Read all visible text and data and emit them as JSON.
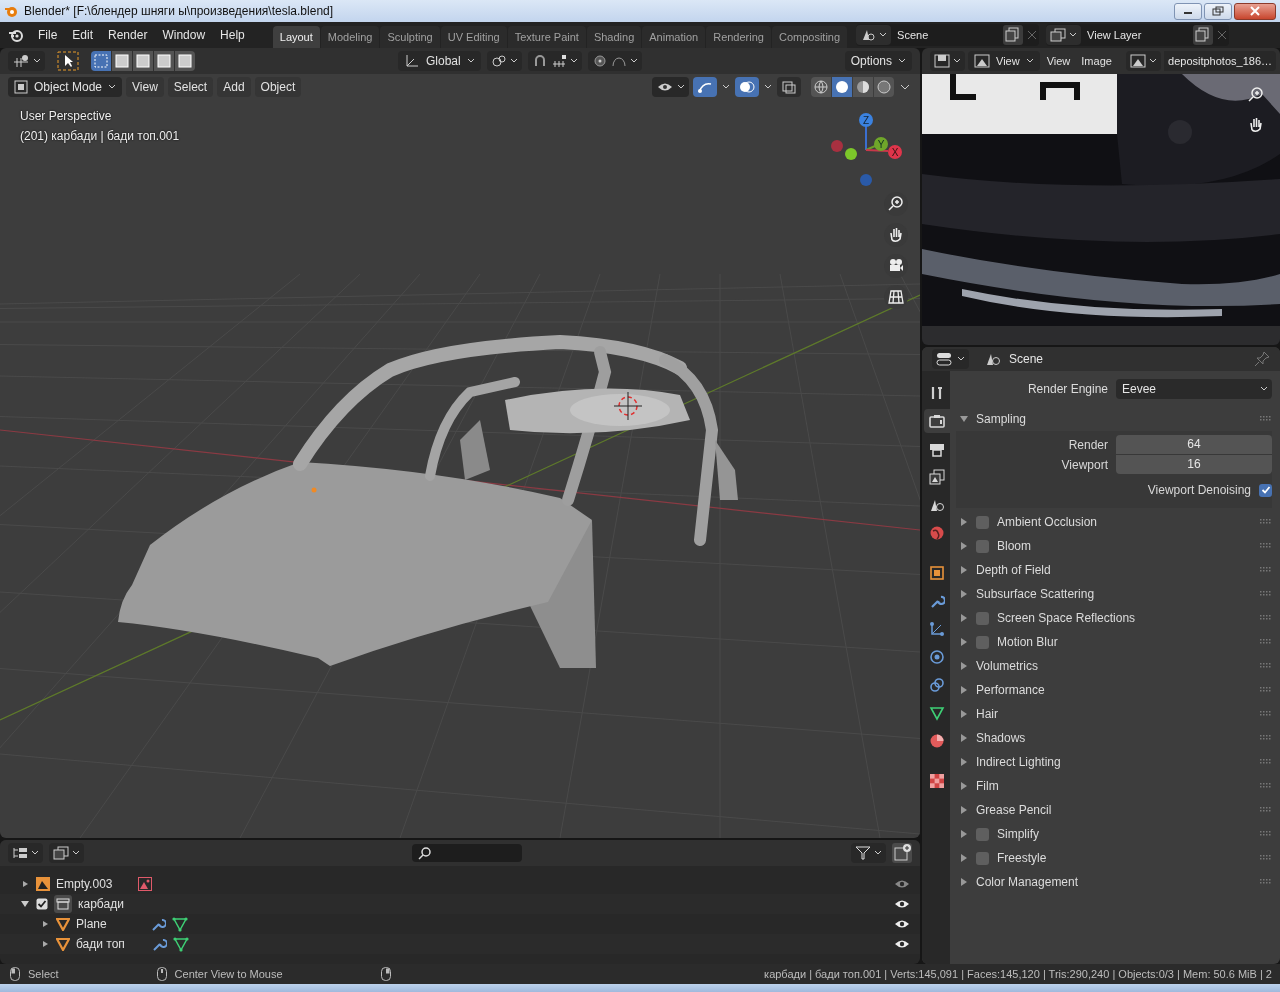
{
  "window": {
    "title": "Blender* [F:\\блендер шняги ы\\произведения\\tesla.blend]"
  },
  "menu": [
    "File",
    "Edit",
    "Render",
    "Window",
    "Help"
  ],
  "workspaces": [
    {
      "label": "Layout",
      "selected": true
    },
    {
      "label": "Modeling",
      "selected": false
    },
    {
      "label": "Sculpting",
      "selected": false
    },
    {
      "label": "UV Editing",
      "selected": false
    },
    {
      "label": "Texture Paint",
      "selected": false
    },
    {
      "label": "Shading",
      "selected": false
    },
    {
      "label": "Animation",
      "selected": false
    },
    {
      "label": "Rendering",
      "selected": false
    },
    {
      "label": "Compositing",
      "selected": false
    }
  ],
  "scene_field": {
    "value": "Scene"
  },
  "view_layer_field": {
    "value": "View Layer"
  },
  "viewport": {
    "select_modes": [
      {
        "selected": true
      },
      {
        "selected": false
      },
      {
        "selected": false
      },
      {
        "selected": false
      },
      {
        "selected": false
      }
    ],
    "transform_orientation": "Global",
    "options": "Options",
    "mode": "Object Mode",
    "menus": [
      "View",
      "Select",
      "Add",
      "Object"
    ],
    "toggles": [
      {
        "kind": "gizmo",
        "on": true
      },
      {
        "kind": "overlays",
        "on": true
      },
      {
        "kind": "xray",
        "on": false
      }
    ],
    "shading": [
      {
        "kind": "wireframe",
        "selected": false
      },
      {
        "kind": "solid",
        "selected": true
      },
      {
        "kind": "material",
        "selected": false
      },
      {
        "kind": "rendered",
        "selected": false
      }
    ],
    "info": [
      "User Perspective",
      "(201) карбади | бади топ.001"
    ],
    "gizmo_axes": [
      "Z",
      "Y",
      "X"
    ]
  },
  "image_editor": {
    "view_mode": "View",
    "menus": [
      "View",
      "Image"
    ],
    "image_name": "depositphotos_186…"
  },
  "properties": {
    "context": "Scene",
    "tabs": [
      {
        "kind": "tool",
        "selected": false
      },
      {
        "kind": "render",
        "selected": true
      },
      {
        "kind": "output",
        "selected": false
      },
      {
        "kind": "view-layer",
        "selected": false
      },
      {
        "kind": "scene",
        "selected": false
      },
      {
        "kind": "world",
        "selected": false
      },
      {
        "kind": "object",
        "selected": false
      },
      {
        "kind": "modifier",
        "selected": false
      },
      {
        "kind": "particles",
        "selected": false
      },
      {
        "kind": "physics",
        "selected": false
      },
      {
        "kind": "constraints",
        "selected": false
      },
      {
        "kind": "data",
        "selected": false
      },
      {
        "kind": "material",
        "selected": false
      },
      {
        "kind": "texture",
        "selected": false
      }
    ],
    "render_engine": {
      "label": "Render Engine",
      "value": "Eevee"
    },
    "panels": [
      {
        "title": "Sampling",
        "kind": "plain",
        "expanded": true,
        "fields": [
          {
            "label": "Render",
            "value": "64"
          },
          {
            "label": "Viewport",
            "value": "16"
          }
        ],
        "checkbox": {
          "label": "Viewport Denoising",
          "checked": true
        }
      },
      {
        "title": "Ambient Occlusion",
        "kind": "toggle",
        "enabled": false,
        "expanded": false
      },
      {
        "title": "Bloom",
        "kind": "toggle",
        "enabled": false,
        "expanded": false
      },
      {
        "title": "Depth of Field",
        "kind": "plain",
        "expanded": false
      },
      {
        "title": "Subsurface Scattering",
        "kind": "plain",
        "expanded": false
      },
      {
        "title": "Screen Space Reflections",
        "kind": "toggle",
        "enabled": false,
        "expanded": false
      },
      {
        "title": "Motion Blur",
        "kind": "toggle",
        "enabled": false,
        "expanded": false
      },
      {
        "title": "Volumetrics",
        "kind": "plain",
        "expanded": false
      },
      {
        "title": "Performance",
        "kind": "plain",
        "expanded": false
      },
      {
        "title": "Hair",
        "kind": "plain",
        "expanded": false
      },
      {
        "title": "Shadows",
        "kind": "plain",
        "expanded": false
      },
      {
        "title": "Indirect Lighting",
        "kind": "plain",
        "expanded": false
      },
      {
        "title": "Film",
        "kind": "plain",
        "expanded": false
      },
      {
        "title": "Grease Pencil",
        "kind": "plain",
        "expanded": false
      },
      {
        "title": "Simplify",
        "kind": "toggle",
        "enabled": false,
        "expanded": false
      },
      {
        "title": "Freestyle",
        "kind": "toggle",
        "enabled": false,
        "expanded": false
      },
      {
        "title": "Color Management",
        "kind": "plain",
        "expanded": false
      }
    ]
  },
  "outliner": {
    "rows": [
      {
        "name": "Empty.003",
        "kind": "empty",
        "expanded": false,
        "visible": false
      },
      {
        "name": "карбади",
        "kind": "collection",
        "expanded": true,
        "checked": true,
        "visible": true,
        "children": [
          {
            "name": "Plane",
            "kind": "mesh",
            "expanded": false,
            "visible": true
          },
          {
            "name": "бади топ",
            "kind": "mesh",
            "expanded": false,
            "visible": true
          }
        ]
      }
    ]
  },
  "status_bar": {
    "hints": [
      {
        "kind": "left",
        "label": "Select"
      },
      {
        "kind": "middle",
        "label": "Center View to Mouse"
      },
      {
        "kind": "right"
      }
    ],
    "stats": "карбади | бади топ.001 | Verts:145,091 | Faces:145,120 | Tris:290,240 | Objects:0/3 | Mem: 50.6 MiB | 2"
  }
}
